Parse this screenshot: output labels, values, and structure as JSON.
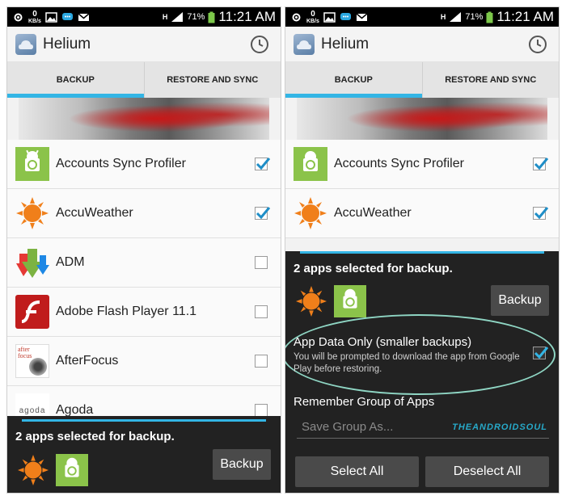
{
  "status_bar": {
    "time": "11:21 AM",
    "battery": "71%",
    "net_speed": "0",
    "net_unit": "KB/s",
    "h_indicator": "H"
  },
  "app": {
    "title": "Helium"
  },
  "tabs": [
    {
      "label": "BACKUP",
      "active": true
    },
    {
      "label": "RESTORE AND SYNC",
      "active": false
    }
  ],
  "apps": [
    {
      "name": "Accounts Sync Profiler",
      "icon": "android-sync-icon",
      "checked": true
    },
    {
      "name": "AccuWeather",
      "icon": "sun-icon",
      "checked": true
    },
    {
      "name": "ADM",
      "icon": "download-arrows-icon",
      "checked": false
    },
    {
      "name": "Adobe Flash Player 11.1",
      "icon": "flash-icon",
      "checked": false
    },
    {
      "name": "AfterFocus",
      "icon": "afterfocus-icon",
      "checked": false,
      "icon_text": "after focus"
    },
    {
      "name": "Agoda",
      "icon": "agoda-icon",
      "checked": false,
      "icon_text": "agoda"
    }
  ],
  "bottom_panel": {
    "title": "2 apps selected for backup.",
    "backup_label": "Backup"
  },
  "dialog": {
    "title": "2 apps selected for backup.",
    "backup_label": "Backup",
    "option_title": "App Data Only (smaller backups)",
    "option_subtitle": "You will be prompted to download the app from Google Play before restoring.",
    "option_checked": true,
    "remember_label": "Remember Group of Apps",
    "save_placeholder": "Save Group As...",
    "watermark": "THEANDROIDSOUL",
    "select_all_label": "Select All",
    "deselect_all_label": "Deselect All"
  },
  "colors": {
    "accent": "#33b5e5",
    "panel_bg": "#222222",
    "button_bg": "#4a4a4a",
    "highlight_ellipse": "#8fd6c4"
  }
}
